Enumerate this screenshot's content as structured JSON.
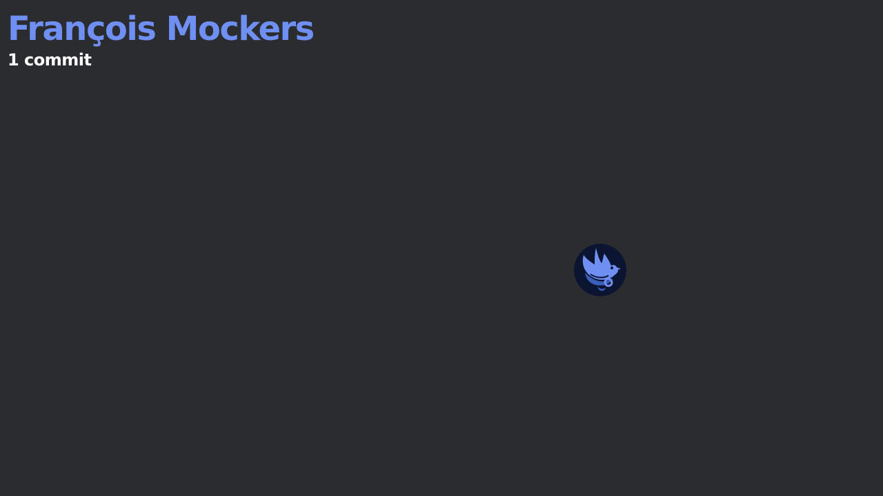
{
  "contributor": {
    "name": "François Mockers",
    "commits": "1 commit",
    "avatar_icon": "bird-avatar-icon"
  },
  "colors": {
    "background": "#2b2c30",
    "name": "#6f8ff2",
    "commits": "#ffffff",
    "avatar_bg": "#0b1430",
    "avatar_bird": "#6f8ff2"
  }
}
